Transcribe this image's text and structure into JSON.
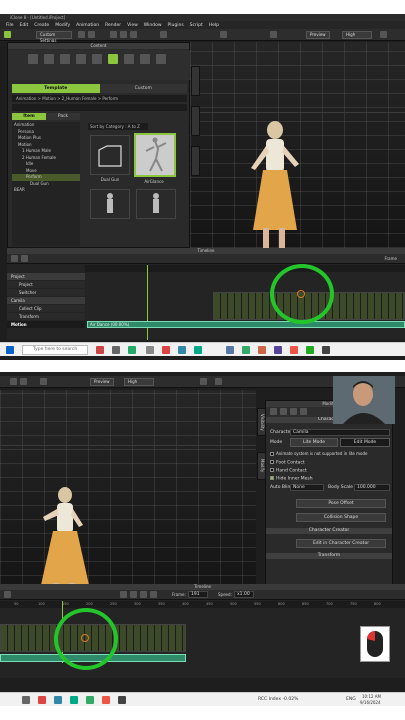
{
  "top": {
    "window_title": "iClone 8 - [Untitled.iProject]",
    "menu": [
      "File",
      "Edit",
      "Create",
      "Modify",
      "Animation",
      "Render",
      "View",
      "Window",
      "Plugins",
      "Script",
      "Help"
    ],
    "toolbar": {
      "custom_settings": "Custom Settings",
      "preview": "Preview",
      "quality": "High"
    },
    "content": {
      "title": "Content",
      "tabs": [
        "Template",
        "Custom"
      ],
      "breadcrumb": "Animation > Motion > 2_Human Female > Perform",
      "sub_tabs": [
        "Item",
        "Pack"
      ],
      "sort": "Sort by Category : A to Z",
      "tree": [
        "Animation",
        "Persona",
        "Motion Plus",
        "Motion",
        "1 Human Male",
        "2 Human Female",
        "Idle",
        "Move",
        "Perform",
        "Dual Gun",
        "BEAR"
      ],
      "thumbs": [
        "Dual Gun",
        "AirGlance",
        "",
        ""
      ]
    },
    "timeline": {
      "title": "Timeline",
      "tracks": [
        "Project",
        "Project",
        "Switcher",
        "Camila",
        "Collect Clip",
        "Transform",
        "Motion"
      ],
      "clip_label": "Air Dance (00:00%)",
      "frame_label": "Frame"
    },
    "taskbar": {
      "search_placeholder": "Type here to search"
    }
  },
  "bottom": {
    "toolbar": {
      "preview": "Preview",
      "quality": "High"
    },
    "modify": {
      "title": "Modify",
      "section_character": "Character",
      "character_label": "Character",
      "character_value": "Camila",
      "mode_label": "Mode",
      "mode_lite": "Lite Mode",
      "mode_edit": "Edit Mode",
      "note": "Animate system is not supported in lite mode",
      "foot_contact": "Foot Contact",
      "hand_contact": "Hand Contact",
      "hide_inner_mesh": "Hide Inner Mesh",
      "auto_blink_label": "Auto Blink",
      "auto_blink_value": "None",
      "body_scale_label": "Body Scale",
      "body_scale_value": "100.000",
      "pose_offset": "Pose Offset",
      "collision_shape": "Collision Shape",
      "section_creator": "Character Creator",
      "edit_in_cc": "Edit in Character Creator",
      "section_transform": "Transform"
    },
    "side_tabs": [
      "Visibility",
      "Modify",
      "Layer"
    ],
    "timeline": {
      "title": "Timeline",
      "frame_label": "Frame:",
      "frame_value": "191",
      "speed_label": "Speed:",
      "speed_value": "x1.00",
      "ticks": [
        "50",
        "100",
        "150",
        "200",
        "250",
        "300",
        "350",
        "400",
        "450",
        "500",
        "550",
        "600",
        "650",
        "700",
        "750",
        "800"
      ]
    },
    "taskbar": {
      "status": "RCC Index -0.02%",
      "lang": "ENG",
      "time": "10:12 AM",
      "date": "9/16/2024"
    }
  },
  "colors": {
    "accent": "#8cc63f",
    "highlight_circle": "#23c52a",
    "clip": "#2f8a6a"
  }
}
